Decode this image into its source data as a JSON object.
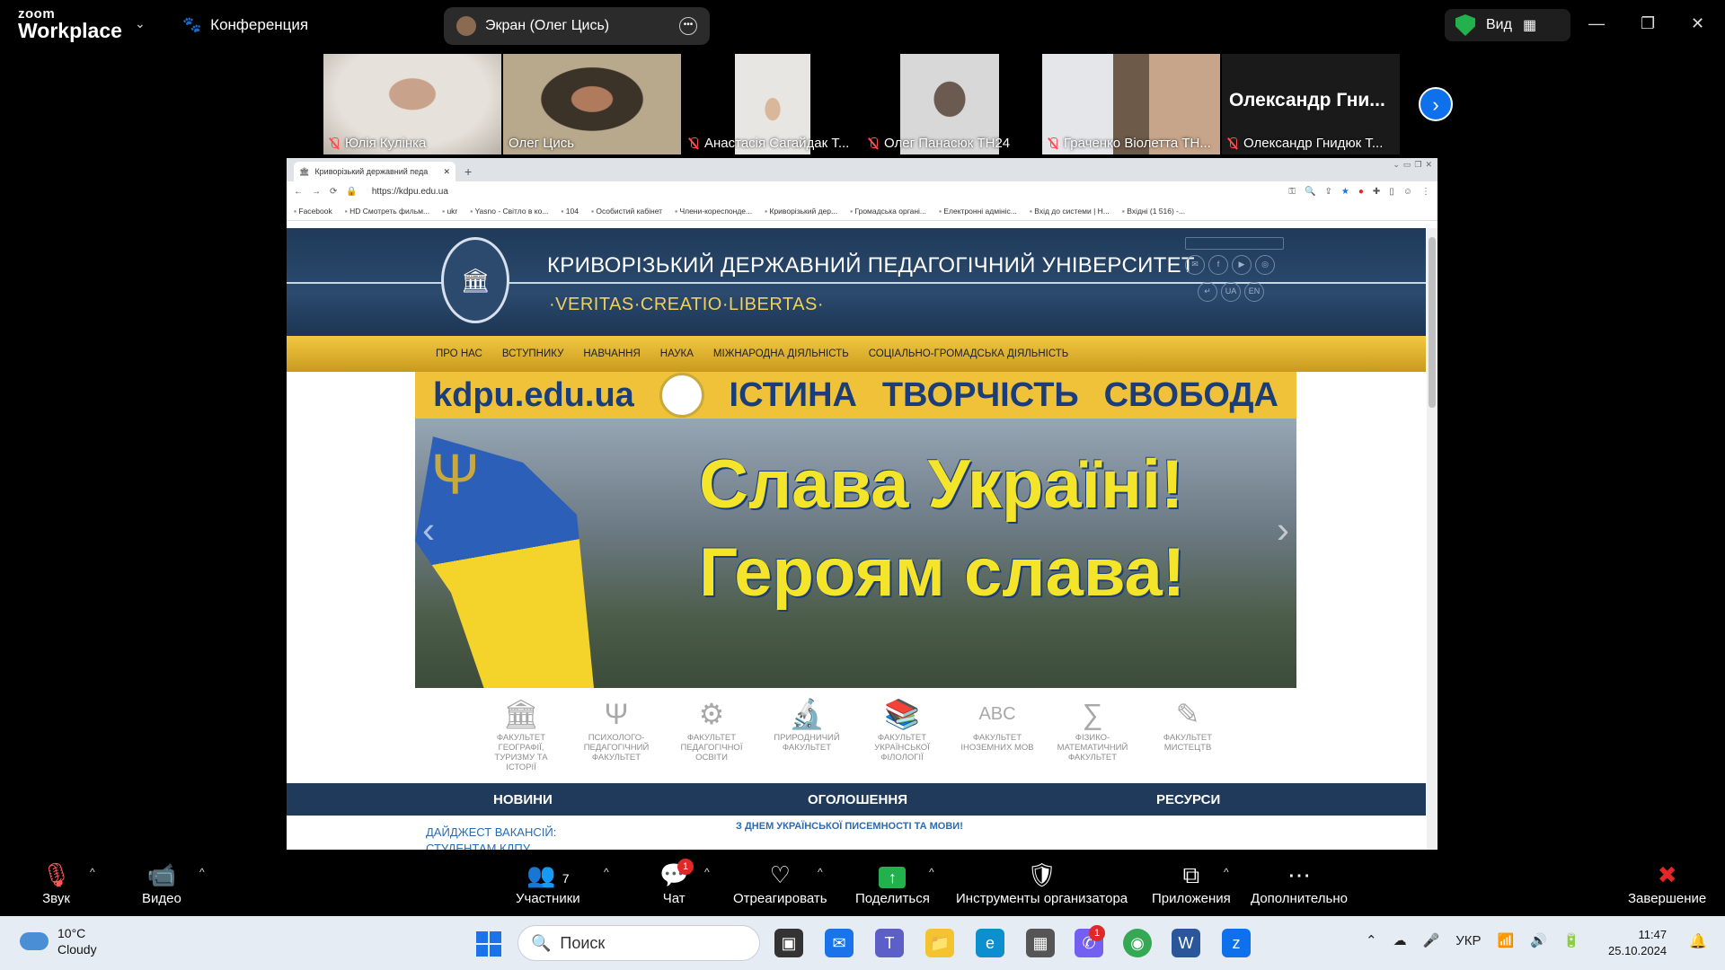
{
  "top": {
    "brand_top": "zoom",
    "brand_bottom": "Workplace",
    "conference_label": "Конференция",
    "screen_share_label": "Экран (Олег Цись)",
    "view_label": "Вид"
  },
  "participants": [
    {
      "name": "Юлія Кулінка",
      "muted": true
    },
    {
      "name": "Олег Цись",
      "muted": false,
      "active": true
    },
    {
      "name": "Анастасія Сагайдак Т...",
      "muted": true
    },
    {
      "name": "Олег Панасюк ТН24",
      "muted": true
    },
    {
      "name": "Граченко Віолетта ТН...",
      "muted": true
    },
    {
      "name": "Олександр Гнидюк Т...",
      "muted": true,
      "big_name": "Олександр Гни..."
    }
  ],
  "browser": {
    "tab_title": "Криворізький державний педа",
    "url": "https://kdpu.edu.ua",
    "bookmarks": [
      "Facebook",
      "HD Смотреть фильм...",
      "ukr",
      "Yasno - Світло в ко...",
      "104",
      "Особистий кабінет",
      "Члени-кореспонде...",
      "Криворізький дер...",
      "Громадська органі...",
      "Електронні адмініс...",
      "Вхід до системи | Н...",
      "Вхідні (1 516) -..."
    ]
  },
  "site": {
    "university": "КРИВОРІЗЬКИЙ ДЕРЖАВНИЙ ПЕДАГОГІЧНИЙ УНІВЕРСИТЕТ",
    "motto": "·VERITAS·CREATIO·LIBERTAS·",
    "lang_ua": "UA",
    "lang_en": "EN",
    "nav": [
      "ПРО НАС",
      "ВСТУПНИКУ",
      "НАВЧАННЯ",
      "НАУКА",
      "МІЖНАРОДНА ДІЯЛЬНІСТЬ",
      "СОЦІАЛЬНО-ГРОМАДСЬКА ДІЯЛЬНІСТЬ"
    ],
    "banner_domain": "kdpu.edu.ua",
    "banner_words": [
      "ІСТИНА",
      "ТВОРЧІСТЬ",
      "СВОБОДА"
    ],
    "slava_line1": "Слава Україні!",
    "slava_line2": "Героям слава!",
    "faculties": [
      {
        "label": "ФАКУЛЬТЕТ ГЕОГРАФІЇ, ТУРИЗМУ ТА ІСТОРІЇ",
        "icon": "column-icon"
      },
      {
        "label": "ПСИХОЛОГО-ПЕДАГОГІЧНИЙ ФАКУЛЬТЕТ",
        "icon": "psi-icon"
      },
      {
        "label": "ФАКУЛЬТЕТ ПЕДАГОГІЧНОЇ ОСВІТИ",
        "icon": "gears-icon"
      },
      {
        "label": "ПРИРОДНИЧИЙ ФАКУЛЬТЕТ",
        "icon": "microscope-icon"
      },
      {
        "label": "ФАКУЛЬТЕТ УКРАЇНСЬКОЇ ФІЛОЛОГІЇ",
        "icon": "books-icon"
      },
      {
        "label": "ФАКУЛЬТЕТ ІНОЗЕМНИХ МОВ",
        "icon": "abc-icon"
      },
      {
        "label": "ФІЗИКО-МАТЕМАТИЧНИЙ ФАКУЛЬТЕТ",
        "icon": "sum-icon"
      },
      {
        "label": "ФАКУЛЬТЕТ МИСТЕЦТВ",
        "icon": "brush-icon"
      }
    ],
    "sections": [
      "НОВИНИ",
      "ОГОЛОШЕННЯ",
      "РЕСУРСИ"
    ],
    "news_first": "ДАЙДЖЕСТ ВАКАНСІЙ:",
    "news_second": "СТУДЕНТАМ КДПУ",
    "announcement_first": "З ДНЕМ УКРАЇНСЬКОЇ ПИСЕМНОСТІ ТА МОВИ!"
  },
  "toolbar": {
    "audio": "Звук",
    "video": "Видео",
    "participants": "Участники",
    "participants_count": "7",
    "chat": "Чат",
    "chat_badge": "1",
    "react": "Отреагировать",
    "share": "Поделиться",
    "host_tools": "Инструменты организатора",
    "apps": "Приложения",
    "more": "Дополнительно",
    "end": "Завершение"
  },
  "taskbar": {
    "temp": "10°C",
    "weather": "Cloudy",
    "search": "Поиск",
    "lang": "УКР",
    "time": "11:47",
    "date": "25.10.2024",
    "viber_badge": "1"
  },
  "colors": {
    "accent": "#0e71eb",
    "active_speaker": "#22d37a",
    "share_green": "#23b14d",
    "site_navy": "#1f3a5a",
    "site_gold": "#f0c23a",
    "end_red": "#e02828"
  }
}
